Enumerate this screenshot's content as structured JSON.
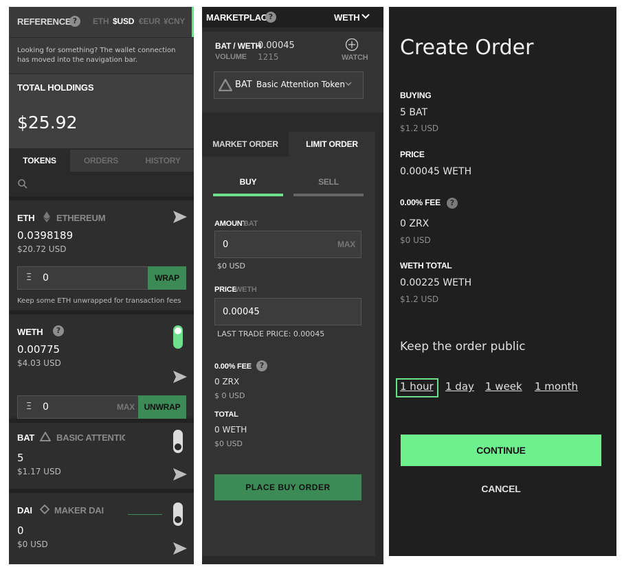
{
  "left": {
    "header": {
      "title": "REFERENCE",
      "currencies": [
        "ETH",
        "$USD",
        "€EUR",
        "¥CNY"
      ],
      "active_currency": "$USD"
    },
    "notice": "Looking for something? The wallet connection has moved into the navigation bar.",
    "holdings": {
      "label": "TOTAL HOLDINGS",
      "value": "$25.92"
    },
    "tabs": [
      "TOKENS",
      "ORDERS",
      "HISTORY"
    ],
    "tokens": [
      {
        "symbol": "ETH",
        "name": "ETHEREUM",
        "amount": "0.0398189",
        "usd": "$20.72 USD"
      },
      {
        "symbol": "WETH",
        "amount": "0.00775",
        "usd": "$4.03 USD"
      },
      {
        "symbol": "BAT",
        "name": "BASIC ATTENTIOI",
        "amount": "5",
        "usd": "$1.17 USD"
      },
      {
        "symbol": "DAI",
        "name": "MAKER DAI",
        "amount": "0",
        "usd": "$0 USD"
      }
    ],
    "wrap": {
      "prefix": "Ξ",
      "value": "0",
      "button": "WRAP",
      "note": "Keep some ETH unwrapped for transaction fees"
    },
    "unwrap": {
      "prefix": "Ξ",
      "value": "0",
      "max": "MAX",
      "button": "UNWRAP"
    }
  },
  "mid": {
    "header": {
      "title": "MARKETPLACE",
      "selector": "WETH"
    },
    "pair": {
      "label": "BAT / WETH",
      "price": "0.00045",
      "volume_label": "VOLUME",
      "volume": "1215",
      "watch": "WATCH"
    },
    "token_select": {
      "symbol": "BAT",
      "name": "Basic Attention Token"
    },
    "order_tabs": [
      "MARKET ORDER",
      "LIMIT ORDER"
    ],
    "side_tabs": [
      "BUY",
      "SELL"
    ],
    "amount": {
      "label": "AMOUNT",
      "unit": "BAT",
      "value": "0",
      "max": "MAX",
      "usd": "$0 USD"
    },
    "price": {
      "label": "PRICE",
      "unit": "WETH",
      "value": "0.00045",
      "last_trade": "LAST TRADE PRICE: 0.00045"
    },
    "fee": {
      "label": "0.00% FEE",
      "value": "0 ZRX",
      "usd": "$ 0 USD"
    },
    "total": {
      "label": "TOTAL",
      "value": "0 WETH",
      "usd": "$0 USD"
    },
    "place_button": "PLACE BUY ORDER"
  },
  "right": {
    "title": "Create Order",
    "buying": {
      "label": "BUYING",
      "value": "5 BAT",
      "usd": "$1.2 USD"
    },
    "price": {
      "label": "PRICE",
      "value": "0.00045 WETH"
    },
    "fee": {
      "label": "0.00% FEE",
      "value": "0 ZRX",
      "usd": "$0 USD"
    },
    "weth_total": {
      "label": "WETH TOTAL",
      "value": "0.00225 WETH",
      "usd": "$1.2 USD"
    },
    "public_label": "Keep the order public",
    "durations": [
      "1 hour",
      "1 day",
      "1 week",
      "1 month"
    ],
    "selected_duration": "1 hour",
    "continue": "CONTINUE",
    "cancel": "CANCEL"
  },
  "colors": {
    "accent_green": "#6ee08d",
    "button_green": "#3c8a56",
    "panel": "#2a2a2a"
  }
}
